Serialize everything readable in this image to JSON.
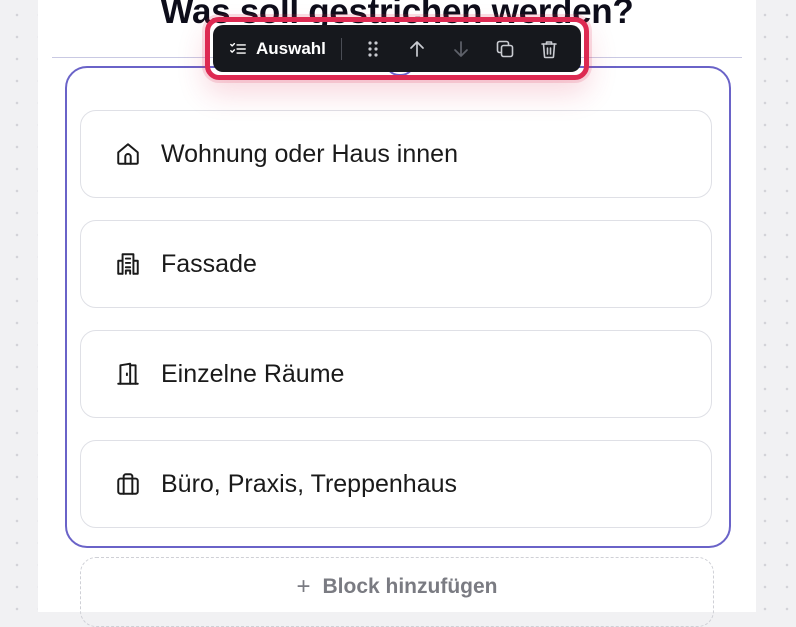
{
  "page": {
    "heading": "Was soll gestrichen werden?"
  },
  "toolbar": {
    "block_type_label": "Auswahl",
    "block_type_icon": "list-check-icon",
    "actions": [
      {
        "icon": "drag-handle-icon"
      },
      {
        "icon": "arrow-up-icon"
      },
      {
        "icon": "arrow-down-icon"
      },
      {
        "icon": "duplicate-icon"
      },
      {
        "icon": "trash-icon"
      }
    ]
  },
  "options": [
    {
      "label": "Wohnung oder Haus innen",
      "icon": "house-icon"
    },
    {
      "label": "Fassade",
      "icon": "building-icon"
    },
    {
      "label": "Einzelne Räume",
      "icon": "door-icon"
    },
    {
      "label": "Büro, Praxis, Treppenhaus",
      "icon": "briefcase-icon"
    }
  ],
  "add_block": {
    "plus": "+",
    "label": "Block hinzufügen"
  },
  "colors": {
    "selection": "#6a63c8",
    "highlight": "#dd2a52",
    "toolbar_bg": "#16181d"
  }
}
